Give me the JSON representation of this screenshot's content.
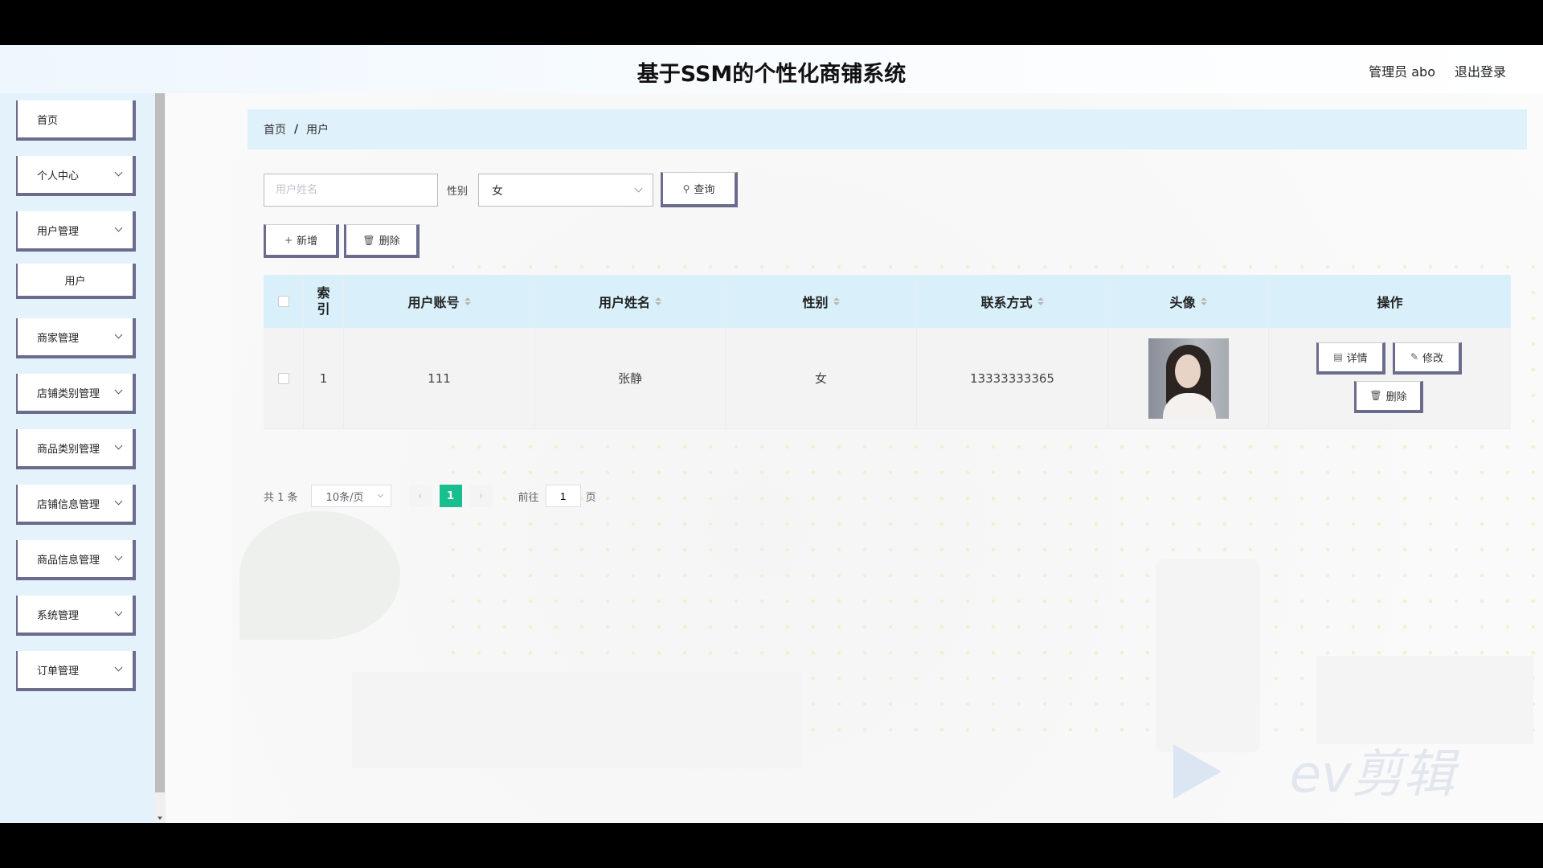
{
  "header": {
    "title": "基于SSM的个性化商铺系统",
    "admin_label": "管理员 abo",
    "logout_label": "退出登录"
  },
  "sidebar": {
    "items": [
      {
        "label": "首页",
        "has_children": false
      },
      {
        "label": "个人中心",
        "has_children": true
      },
      {
        "label": "用户管理",
        "has_children": true
      },
      {
        "label": "用户",
        "has_children": false,
        "sub": true
      },
      {
        "label": "商家管理",
        "has_children": true
      },
      {
        "label": "店铺类别管理",
        "has_children": true
      },
      {
        "label": "商品类别管理",
        "has_children": true
      },
      {
        "label": "店铺信息管理",
        "has_children": true
      },
      {
        "label": "商品信息管理",
        "has_children": true
      },
      {
        "label": "系统管理",
        "has_children": true
      },
      {
        "label": "订单管理",
        "has_children": true
      }
    ]
  },
  "breadcrumb": {
    "home": "首页",
    "separator": "/",
    "current": "用户"
  },
  "search": {
    "name_placeholder": "用户姓名",
    "name_value": "",
    "gender_label": "性别",
    "gender_value": "女",
    "query_label": "查询"
  },
  "actions": {
    "add_label": "新增",
    "delete_label": "删除"
  },
  "table": {
    "headers": {
      "index_line1": "索",
      "index_line2": "引",
      "account": "用户账号",
      "name": "用户姓名",
      "gender": "性别",
      "phone": "联系方式",
      "avatar": "头像",
      "operation": "操作"
    },
    "rows": [
      {
        "index": "1",
        "account": "111",
        "name": "张静",
        "gender": "女",
        "phone": "13333333365",
        "detail_label": "详情",
        "edit_label": "修改",
        "delete_label": "删除"
      }
    ]
  },
  "pagination": {
    "total_text": "共 1 条",
    "page_size": "10条/页",
    "current_page": "1",
    "goto_label": "前往",
    "goto_value": "1",
    "page_suffix": "页"
  },
  "watermark": "ev剪辑",
  "colors": {
    "accent": "#19be8f",
    "header_bg": "#dff1fb",
    "sidebar_bg": "#e4f3fb",
    "button_border": "#6b6b8e"
  }
}
